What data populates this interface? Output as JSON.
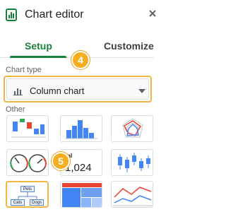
{
  "header": {
    "title": "Chart editor",
    "icon": "chart-editor-icon",
    "accent_color": "#188038"
  },
  "tabs": [
    {
      "label": "Setup",
      "active": true
    },
    {
      "label": "Customize",
      "active": false
    }
  ],
  "chart_type": {
    "section_label": "Chart type",
    "selected_value": "Column chart",
    "icon": "column-chart-icon"
  },
  "other": {
    "section_label": "Other",
    "thumbnails": [
      {
        "name": "waterfall-chart"
      },
      {
        "name": "histogram-chart"
      },
      {
        "name": "radar-chart"
      },
      {
        "name": "gauge-chart"
      },
      {
        "name": "scorecard-chart",
        "label": "tal",
        "value": "1,024"
      },
      {
        "name": "candlestick-chart"
      },
      {
        "name": "org-chart",
        "selected": true,
        "nodes": [
          "Pets",
          "Cats",
          "Dogs"
        ]
      },
      {
        "name": "treemap-chart"
      },
      {
        "name": "timeline-chart"
      }
    ]
  },
  "callouts": [
    {
      "number": "4",
      "color": "#f5ad22"
    },
    {
      "number": "5",
      "color": "#f5ad22"
    }
  ]
}
